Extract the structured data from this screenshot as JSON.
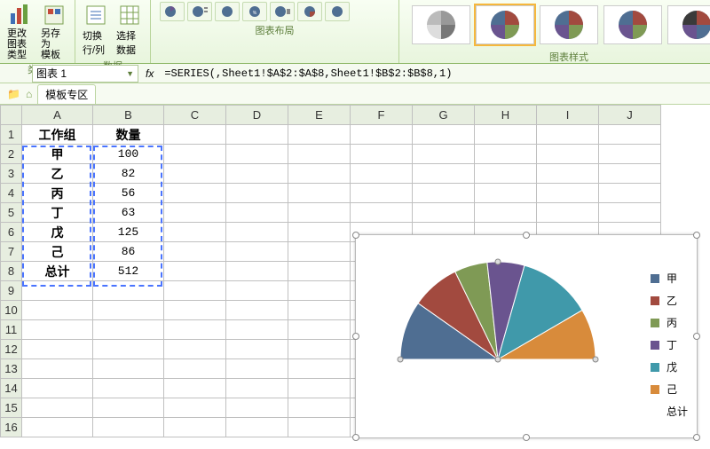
{
  "ribbon": {
    "change_type": "更改\n图表类型",
    "save_as_template": "另存为\n模板",
    "swap_rowcol": "切换行/列",
    "select_data": "选择数据",
    "group_type": "类型",
    "group_data": "数据",
    "group_layout": "图表布局",
    "group_styles": "图表样式"
  },
  "namebox": "图表 1",
  "formula": "=SERIES(,Sheet1!$A$2:$A$8,Sheet1!$B$2:$B$8,1)",
  "tabs": {
    "templates": "模板专区"
  },
  "cols": [
    "A",
    "B",
    "C",
    "D",
    "E",
    "F",
    "G",
    "H",
    "I",
    "J"
  ],
  "headers": {
    "a": "工作组",
    "b": "数量"
  },
  "rows": [
    {
      "label": "甲",
      "value": "100"
    },
    {
      "label": "乙",
      "value": "82"
    },
    {
      "label": "丙",
      "value": "56"
    },
    {
      "label": "丁",
      "value": "63"
    },
    {
      "label": "戊",
      "value": "125"
    },
    {
      "label": "己",
      "value": "86"
    },
    {
      "label": "总计",
      "value": "512"
    }
  ],
  "chart_data": {
    "type": "pie",
    "style": "half",
    "categories": [
      "甲",
      "乙",
      "丙",
      "丁",
      "戊",
      "己",
      "总计"
    ],
    "values": [
      100,
      82,
      56,
      63,
      125,
      86,
      512
    ],
    "colors": [
      "#4f6e92",
      "#a24a3f",
      "#7f9a55",
      "#6a548f",
      "#4099aa",
      "#d88b3b",
      "#ffffff"
    ],
    "legend_position": "right",
    "notes": "总计 slice equals sum of others → renders as the hidden lower half of the semicircle"
  }
}
